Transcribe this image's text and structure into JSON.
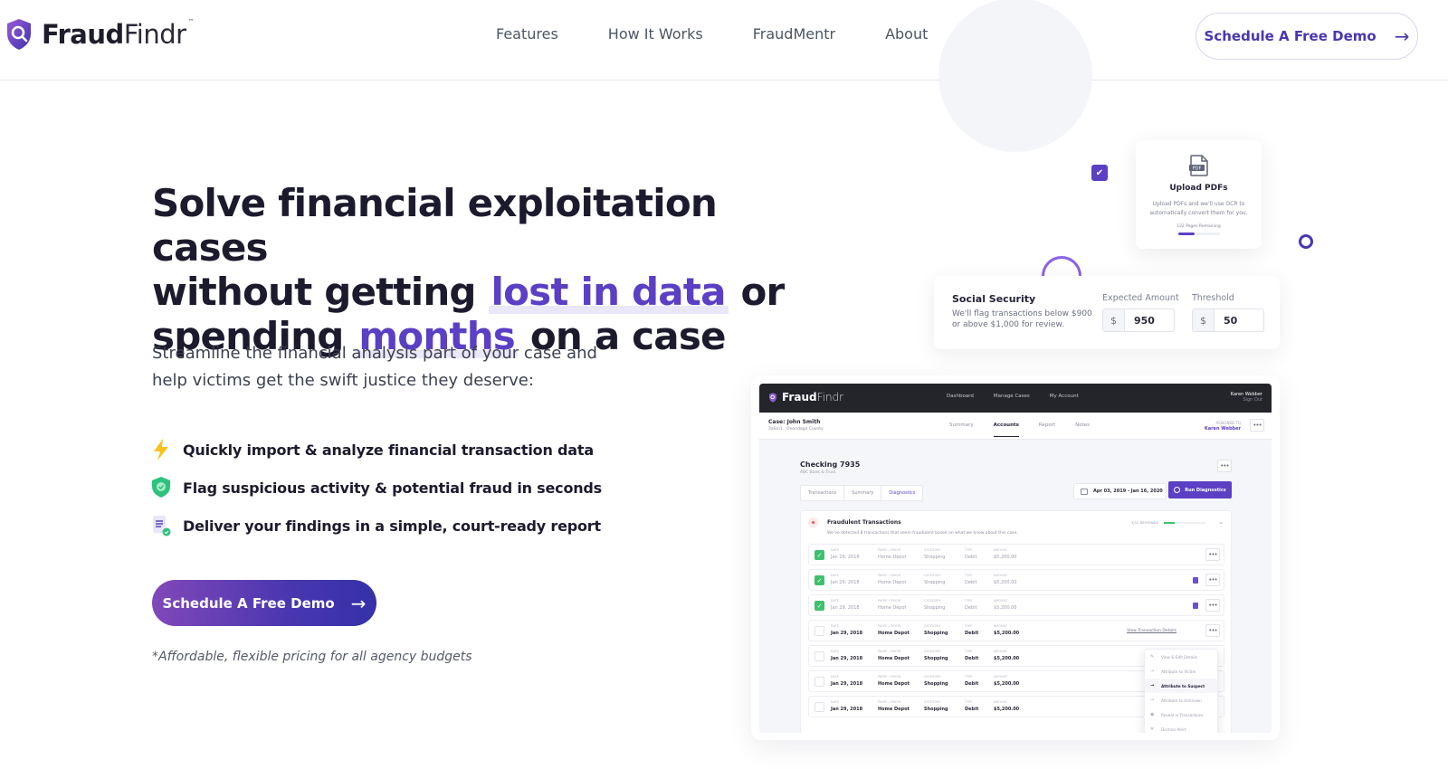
{
  "header": {
    "brand": {
      "bold": "Fraud",
      "light": "Findr",
      "tm": "™"
    },
    "nav": [
      "Features",
      "How It Works",
      "FraudMentr",
      "About"
    ],
    "cta_label": "Schedule A Free Demo",
    "cta_icon": "arrow-right-icon"
  },
  "hero": {
    "title_line1": "Solve financial exploitation cases",
    "title_line2_pre": "without getting",
    "title_line2_hl": "lost in data",
    "title_line2_post": "or",
    "title_line3_pre": "spending",
    "title_line3_hl": "months",
    "title_line3_post": "on a case",
    "subtitle": "Streamline the financial analysis part of your case and help victims get the swift justice they deserve:",
    "features": [
      {
        "icon": "lightning-icon",
        "text": "Quickly import & analyze financial transaction data"
      },
      {
        "icon": "shield-check-icon",
        "text": "Flag suspicious activity & potential fraud in seconds"
      },
      {
        "icon": "report-icon",
        "text": "Deliver your findings in a simple, court-ready report"
      }
    ],
    "cta_label": "Schedule A Free Demo",
    "pricing_note": "*Affordable, flexible pricing for all agency budgets"
  },
  "colors": {
    "brand_purple": "#5b3fc4",
    "dark": "#1c1b2e",
    "success_green": "#3ec16d",
    "lightning_yellow": "#f8c21b"
  },
  "upload_card": {
    "title": "Upload PDFs",
    "description": "Upload PDFs and we'll use OCR to automatically convert them for you.",
    "remaining": "122 Pages Remaining",
    "progress": 0.4,
    "pdf_label": "PDF"
  },
  "social_security_card": {
    "title": "Social Security",
    "description": "We'll flag transactions below $900 or above $1,000 for review.",
    "expected_label": "Expected Amount",
    "expected_prefix": "$",
    "expected_value": "950",
    "threshold_label": "Threshold",
    "threshold_prefix": "$",
    "threshold_value": "50"
  },
  "app": {
    "brand": {
      "bold": "Fraud",
      "light": "Findr"
    },
    "nav": [
      "Dashboard",
      "Manage Cases",
      "My Account"
    ],
    "user_name": "Karen Webber",
    "user_action": "Sign Out",
    "case_title": "Case: John Smith",
    "case_meta": [
      "3aSm1",
      "Onondaga County"
    ],
    "case_tabs": [
      "Summary",
      "Accounts",
      "Report",
      "Notes"
    ],
    "case_tab_active": "Accounts",
    "assigned_label": "ASSIGNED TO",
    "assigned_to": "Karen Webber",
    "account_title": "Checking 7935",
    "account_bank": "ABC Bank & Trust",
    "sub_tabs": [
      "Transactions",
      "Summary",
      "Diagnostics"
    ],
    "sub_tab_active": "Diagnostics",
    "date_range": "Apr 03, 2019  -  Jan 16, 2020",
    "run_label": "Run Diagnostics",
    "diag_title": "Fraudulent Transactions",
    "diag_desc": "We've detected 8 transactions that seem fraudulent based on what we know about this case.",
    "reviewed_label": "3/12 REVIEWED",
    "reviewed_fraction": 0.25,
    "columns": [
      "DATE",
      "PAYEE / PAYOR",
      "CATEGORY",
      "TYPE",
      "AMOUNT"
    ],
    "transactions": [
      {
        "checked": true,
        "date": "Jan 29, 2018",
        "payee": "Home Depot",
        "category": "Shopping",
        "type": "Debit",
        "amount": "$5,200.00",
        "doc": false,
        "link": ""
      },
      {
        "checked": true,
        "date": "Jan 29, 2018",
        "payee": "Home Depot",
        "category": "Shopping",
        "type": "Debit",
        "amount": "$5,200.00",
        "doc": true,
        "link": ""
      },
      {
        "checked": true,
        "date": "Jan 29, 2018",
        "payee": "Home Depot",
        "category": "Shopping",
        "type": "Debit",
        "amount": "$5,200.00",
        "doc": true,
        "link": ""
      },
      {
        "checked": false,
        "date": "Jan 29, 2018",
        "payee": "Home Depot",
        "category": "Shopping",
        "type": "Debit",
        "amount": "$5,200.00",
        "doc": false,
        "link": "View Transaction Details"
      },
      {
        "checked": false,
        "date": "Jan 29, 2018",
        "payee": "Home Depot",
        "category": "Shopping",
        "type": "Debit",
        "amount": "$5,200.00",
        "doc": false,
        "link": ""
      },
      {
        "checked": false,
        "date": "Jan 29, 2018",
        "payee": "Home Depot",
        "category": "Shopping",
        "type": "Debit",
        "amount": "$5,200.00",
        "doc": false,
        "link": ""
      },
      {
        "checked": false,
        "date": "Jan 29, 2018",
        "payee": "Home Depot",
        "category": "Shopping",
        "type": "Debit",
        "amount": "$5,200.00",
        "doc": false,
        "link": ""
      }
    ],
    "menu": [
      {
        "icon": "pencil-icon",
        "glyph": "✎",
        "label": "View & Edit Details",
        "active": false
      },
      {
        "icon": "arrow-right-icon",
        "glyph": "→",
        "label": "Attribute to Victim",
        "active": false
      },
      {
        "icon": "arrow-right-icon",
        "glyph": "→",
        "label": "Attribute to Suspect",
        "active": true
      },
      {
        "icon": "arrow-right-icon",
        "glyph": "→",
        "label": "Attribute to Unknown",
        "active": false
      },
      {
        "icon": "eye-icon",
        "glyph": "◉",
        "label": "Reveal in Transactions",
        "active": false
      },
      {
        "icon": "close-icon",
        "glyph": "✕",
        "label": "Dismiss Alert",
        "active": false
      }
    ]
  }
}
